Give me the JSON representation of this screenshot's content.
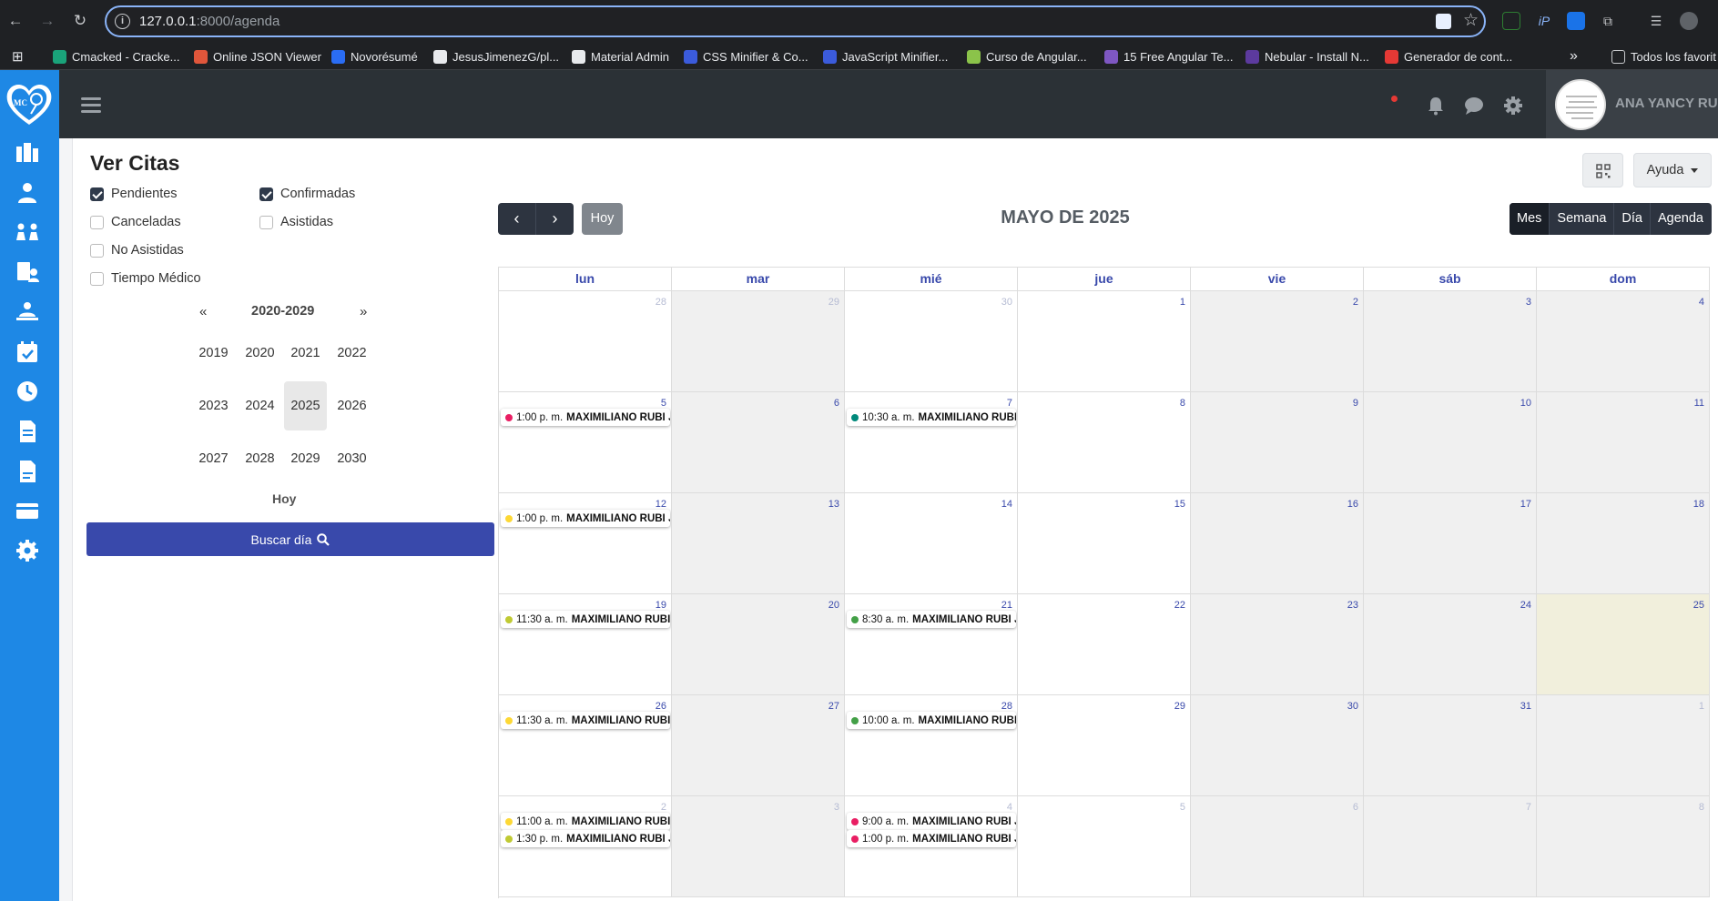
{
  "browser": {
    "url_host": "127.0.0.1",
    "url_path": ":8000/agenda",
    "bookmarks": [
      {
        "label": "Cmacked - Cracke...",
        "color": "#1aa37a"
      },
      {
        "label": "Online JSON Viewer",
        "color": "#e0563b"
      },
      {
        "label": "Novorésumé",
        "color": "#2a6df4"
      },
      {
        "label": "JesusJimenezG/pl...",
        "color": "#e8eaed"
      },
      {
        "label": "Material Admin",
        "color": "#e8eaed"
      },
      {
        "label": "CSS Minifier & Co...",
        "color": "#3b5bdb"
      },
      {
        "label": "JavaScript Minifier...",
        "color": "#3b5bdb"
      },
      {
        "label": "Curso de Angular...",
        "color": "#8bc34a"
      },
      {
        "label": "15 Free Angular Te...",
        "color": "#7e57c2"
      },
      {
        "label": "Nebular - Install N...",
        "color": "#5c3a9e"
      },
      {
        "label": "Generador de cont...",
        "color": "#e53935"
      }
    ],
    "bookmarks_more": "»",
    "all_bookmarks": "Todos los favorit"
  },
  "header": {
    "user_name": "ANA YANCY RUBI"
  },
  "filters": {
    "title": "Ver Citas",
    "options": [
      {
        "label": "Pendientes",
        "checked": true
      },
      {
        "label": "Confirmadas",
        "checked": true
      },
      {
        "label": "Canceladas",
        "checked": false
      },
      {
        "label": "Asistidas",
        "checked": false
      },
      {
        "label": "No Asistidas",
        "checked": false
      },
      {
        "label": "Tiempo Médico",
        "checked": false
      }
    ]
  },
  "year_picker": {
    "prev": "«",
    "next": "»",
    "decade": "2020-2029",
    "years": [
      "2019",
      "2020",
      "2021",
      "2022",
      "2023",
      "2024",
      "2025",
      "2026",
      "2027",
      "2028",
      "2029",
      "2030"
    ],
    "selected": "2025",
    "today_link": "Hoy",
    "search_button": "Buscar día"
  },
  "toolbar": {
    "prev": "‹",
    "next": "›",
    "today": "Hoy",
    "title": "MAYO DE 2025",
    "views": [
      "Mes",
      "Semana",
      "Día",
      "Agenda"
    ],
    "active_view": "Mes",
    "help": "Ayuda"
  },
  "calendar": {
    "weekdays": [
      "lun",
      "mar",
      "mié",
      "jue",
      "vie",
      "sáb",
      "dom"
    ],
    "weeks": [
      [
        {
          "n": "28",
          "other": true
        },
        {
          "n": "29",
          "other": true
        },
        {
          "n": "30",
          "other": true
        },
        {
          "n": "1"
        },
        {
          "n": "2"
        },
        {
          "n": "3"
        },
        {
          "n": "4"
        }
      ],
      [
        {
          "n": "5",
          "events": [
            {
              "time": "1:00 p. m.",
              "name": "MAXIMILIANO RUBI J",
              "color": "#e91e63"
            }
          ]
        },
        {
          "n": "6"
        },
        {
          "n": "7",
          "events": [
            {
              "time": "10:30 a. m.",
              "name": "MAXIMILIANO RUBI",
              "color": "#00897b"
            }
          ]
        },
        {
          "n": "8"
        },
        {
          "n": "9"
        },
        {
          "n": "10"
        },
        {
          "n": "11"
        }
      ],
      [
        {
          "n": "12",
          "events": [
            {
              "time": "1:00 p. m.",
              "name": "MAXIMILIANO RUBI J",
              "color": "#fdd835"
            }
          ]
        },
        {
          "n": "13"
        },
        {
          "n": "14"
        },
        {
          "n": "15"
        },
        {
          "n": "16"
        },
        {
          "n": "17"
        },
        {
          "n": "18"
        }
      ],
      [
        {
          "n": "19",
          "events": [
            {
              "time": "11:30 a. m.",
              "name": "MAXIMILIANO RUBI",
              "color": "#c0ca33"
            }
          ]
        },
        {
          "n": "20"
        },
        {
          "n": "21",
          "events": [
            {
              "time": "8:30 a. m.",
              "name": "MAXIMILIANO RUBI J",
              "color": "#43a047"
            }
          ]
        },
        {
          "n": "22"
        },
        {
          "n": "23"
        },
        {
          "n": "24"
        },
        {
          "n": "25",
          "today": true
        }
      ],
      [
        {
          "n": "26",
          "events": [
            {
              "time": "11:30 a. m.",
              "name": "MAXIMILIANO RUBI",
              "color": "#fdd835"
            }
          ]
        },
        {
          "n": "27"
        },
        {
          "n": "28",
          "events": [
            {
              "time": "10:00 a. m.",
              "name": "MAXIMILIANO RUBI",
              "color": "#43a047"
            }
          ]
        },
        {
          "n": "29"
        },
        {
          "n": "30"
        },
        {
          "n": "31"
        },
        {
          "n": "1",
          "other": true
        }
      ],
      [
        {
          "n": "2",
          "other": true,
          "events": [
            {
              "time": "11:00 a. m.",
              "name": "MAXIMILIANO RUBI",
              "color": "#fdd835"
            },
            {
              "time": "1:30 p. m.",
              "name": "MAXIMILIANO RUBI J",
              "color": "#c0ca33"
            }
          ]
        },
        {
          "n": "3",
          "other": true
        },
        {
          "n": "4",
          "other": true,
          "events": [
            {
              "time": "9:00 a. m.",
              "name": "MAXIMILIANO RUBI J",
              "color": "#e91e63"
            },
            {
              "time": "1:00 p. m.",
              "name": "MAXIMILIANO RUBI J",
              "color": "#e91e63"
            }
          ]
        },
        {
          "n": "5",
          "other": true
        },
        {
          "n": "6",
          "other": true
        },
        {
          "n": "7",
          "other": true
        },
        {
          "n": "8",
          "other": true
        }
      ]
    ]
  }
}
